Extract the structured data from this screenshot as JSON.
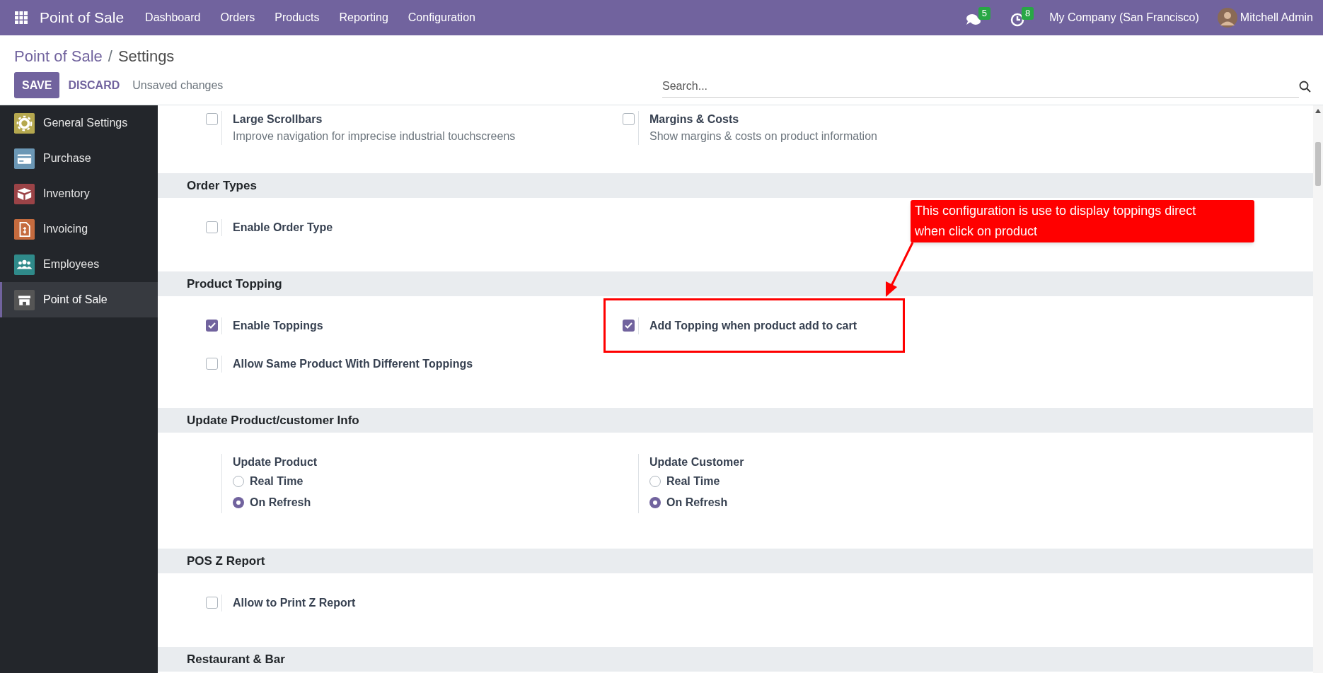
{
  "topbar": {
    "app_name": "Point of Sale",
    "menu": [
      "Dashboard",
      "Orders",
      "Products",
      "Reporting",
      "Configuration"
    ],
    "messages_count": "5",
    "activities_count": "8",
    "company": "My Company (San Francisco)",
    "user": "Mitchell Admin"
  },
  "control_panel": {
    "breadcrumb_parent": "Point of Sale",
    "breadcrumb_separator": "/",
    "breadcrumb_current": "Settings",
    "save": "SAVE",
    "discard": "DISCARD",
    "status": "Unsaved changes",
    "search_placeholder": "Search..."
  },
  "sidebar": {
    "items": [
      {
        "label": "General Settings",
        "kind": "gear",
        "color": "#b5a84f",
        "selected": false
      },
      {
        "label": "Purchase",
        "kind": "card",
        "color": "#6b97b5",
        "selected": false
      },
      {
        "label": "Inventory",
        "kind": "box",
        "color": "#9b4347",
        "selected": false
      },
      {
        "label": "Invoicing",
        "kind": "invoice",
        "color": "#c56b3e",
        "selected": false
      },
      {
        "label": "Employees",
        "kind": "people",
        "color": "#2f8a8a",
        "selected": false
      },
      {
        "label": "Point of Sale",
        "kind": "store",
        "color": "#555555",
        "selected": true
      }
    ]
  },
  "sections": [
    {
      "settings": [
        {
          "kind": "checkbox",
          "label": "Large Scrollbars",
          "description": "Improve navigation for imprecise industrial touchscreens",
          "checked": false
        },
        {
          "kind": "checkbox",
          "label": "Margins & Costs",
          "description": "Show margins & costs on product information",
          "checked": false
        }
      ]
    },
    {
      "title": "Order Types",
      "settings": [
        {
          "kind": "checkbox",
          "label": "Enable Order Type",
          "checked": false
        }
      ]
    },
    {
      "title": "Product Topping",
      "settings": [
        {
          "kind": "checkbox",
          "label": "Enable Toppings",
          "checked": true
        },
        {
          "kind": "checkbox",
          "label": "Add Topping when product add to cart",
          "checked": true
        },
        {
          "kind": "checkbox",
          "label": "Allow Same Product With Different Toppings",
          "checked": false
        }
      ]
    },
    {
      "title": "Update Product/customer Info",
      "settings": [
        {
          "kind": "radio_group",
          "label": "Update Product",
          "options": [
            {
              "label": "Real Time",
              "selected": false
            },
            {
              "label": "On Refresh",
              "selected": true
            }
          ]
        },
        {
          "kind": "radio_group",
          "label": "Update Customer",
          "options": [
            {
              "label": "Real Time",
              "selected": false
            },
            {
              "label": "On Refresh",
              "selected": true
            }
          ]
        }
      ]
    },
    {
      "title": "POS Z Report",
      "settings": [
        {
          "kind": "checkbox",
          "label": "Allow to Print Z Report",
          "checked": false
        }
      ]
    },
    {
      "title": "Restaurant & Bar"
    }
  ],
  "annotation": {
    "text": "This configuration is use to display toppings direct when click on product"
  }
}
